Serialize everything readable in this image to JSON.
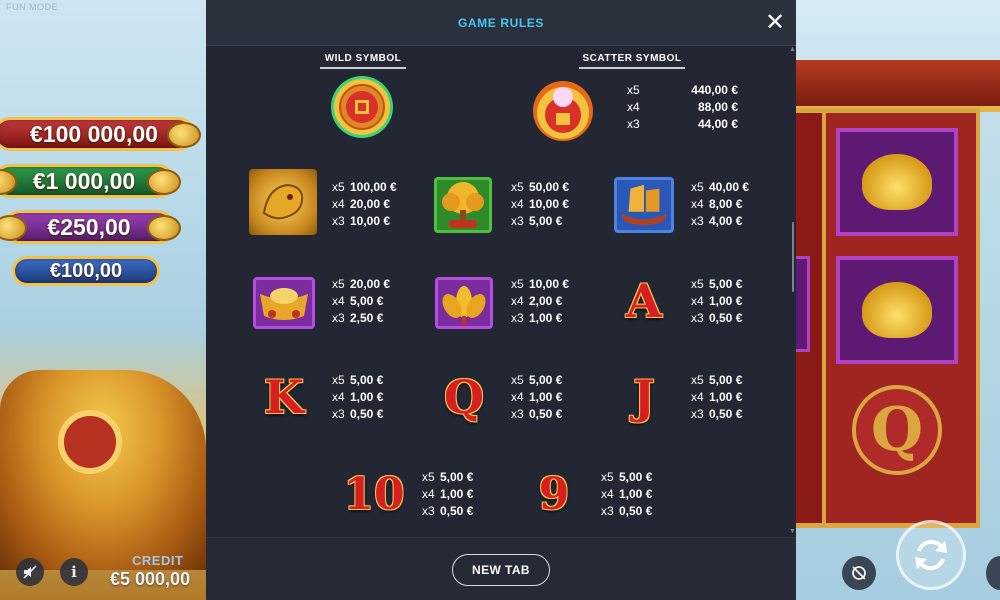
{
  "app": {
    "mode_label": "FUN MODE"
  },
  "jackpots": [
    "€100 000,00",
    "€1 000,00",
    "€250,00",
    "€100,00"
  ],
  "credit": {
    "label": "CREDIT",
    "value": "€5 000,00"
  },
  "modal": {
    "title": "GAME RULES",
    "close_label": "✕",
    "new_tab_label": "NEW TAB"
  },
  "wild": {
    "heading": "WILD SYMBOL",
    "icon": "coin-icon"
  },
  "scatter": {
    "heading": "SCATTER SYMBOL",
    "icon": "golden-bag-icon",
    "pays": [
      {
        "mult": "x5",
        "amount": "440,00 €"
      },
      {
        "mult": "x4",
        "amount": "88,00 €"
      },
      {
        "mult": "x3",
        "amount": "44,00 €"
      }
    ]
  },
  "symbols": [
    {
      "icon": "dragon-icon",
      "pays": [
        {
          "mult": "x5",
          "amount": "100,00 €"
        },
        {
          "mult": "x4",
          "amount": "20,00 €"
        },
        {
          "mult": "x3",
          "amount": "10,00 €"
        }
      ]
    },
    {
      "icon": "money-tree-icon",
      "pays": [
        {
          "mult": "x5",
          "amount": "50,00 €"
        },
        {
          "mult": "x4",
          "amount": "10,00 €"
        },
        {
          "mult": "x3",
          "amount": "5,00 €"
        }
      ]
    },
    {
      "icon": "junk-ship-icon",
      "pays": [
        {
          "mult": "x5",
          "amount": "40,00 €"
        },
        {
          "mult": "x4",
          "amount": "8,00 €"
        },
        {
          "mult": "x3",
          "amount": "4,00 €"
        }
      ]
    },
    {
      "icon": "gold-ingot-icon",
      "pays": [
        {
          "mult": "x5",
          "amount": "20,00 €"
        },
        {
          "mult": "x4",
          "amount": "5,00 €"
        },
        {
          "mult": "x3",
          "amount": "2,50 €"
        }
      ]
    },
    {
      "icon": "lotus-icon",
      "pays": [
        {
          "mult": "x5",
          "amount": "10,00 €"
        },
        {
          "mult": "x4",
          "amount": "2,00 €"
        },
        {
          "mult": "x3",
          "amount": "1,00 €"
        }
      ]
    },
    {
      "letter": "A",
      "pays": [
        {
          "mult": "x5",
          "amount": "5,00 €"
        },
        {
          "mult": "x4",
          "amount": "1,00 €"
        },
        {
          "mult": "x3",
          "amount": "0,50 €"
        }
      ]
    },
    {
      "letter": "K",
      "pays": [
        {
          "mult": "x5",
          "amount": "5,00 €"
        },
        {
          "mult": "x4",
          "amount": "1,00 €"
        },
        {
          "mult": "x3",
          "amount": "0,50 €"
        }
      ]
    },
    {
      "letter": "Q",
      "pays": [
        {
          "mult": "x5",
          "amount": "5,00 €"
        },
        {
          "mult": "x4",
          "amount": "1,00 €"
        },
        {
          "mult": "x3",
          "amount": "0,50 €"
        }
      ]
    },
    {
      "letter": "J",
      "pays": [
        {
          "mult": "x5",
          "amount": "5,00 €"
        },
        {
          "mult": "x4",
          "amount": "1,00 €"
        },
        {
          "mult": "x3",
          "amount": "0,50 €"
        }
      ]
    },
    {
      "letter": "10",
      "pays": [
        {
          "mult": "x5",
          "amount": "5,00 €"
        },
        {
          "mult": "x4",
          "amount": "1,00 €"
        },
        {
          "mult": "x3",
          "amount": "0,50 €"
        }
      ]
    },
    {
      "letter": "9",
      "pays": [
        {
          "mult": "x5",
          "amount": "5,00 €"
        },
        {
          "mult": "x4",
          "amount": "1,00 €"
        },
        {
          "mult": "x3",
          "amount": "0,50 €"
        }
      ]
    }
  ],
  "controls": {
    "sound_icon": "sound-off-icon",
    "info_icon": "info-icon",
    "info_glyph": "i",
    "autoplay_icon": "autoplay-off-icon",
    "spin_icon": "spin-icon"
  }
}
